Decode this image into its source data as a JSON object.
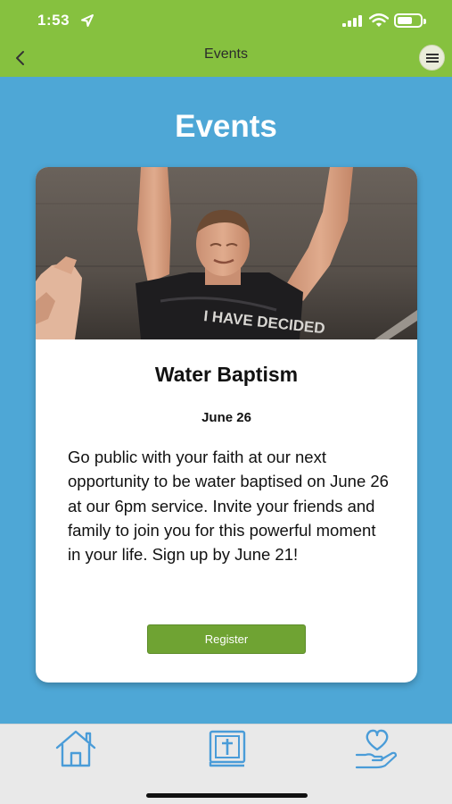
{
  "status_bar": {
    "time": "1:53"
  },
  "nav": {
    "title": "Events"
  },
  "page": {
    "heading": "Events"
  },
  "event": {
    "title": "Water Baptism",
    "date": "June 26",
    "description": "Go public with your faith at our next opportunity to be water baptised on June 26 at our 6pm service. Invite your friends and family to join you for this powerful moment in your life. Sign up by June 21!",
    "register_label": "Register",
    "shirt_text": "I HAVE DECIDED"
  },
  "tabs": [
    {
      "icon": "home-icon"
    },
    {
      "icon": "bible-icon"
    },
    {
      "icon": "giving-heart-icon"
    }
  ],
  "colors": {
    "header_green": "#86c13f",
    "page_blue": "#4ea7d6",
    "button_green": "#6fa333",
    "icon_blue": "#4a9cd8"
  }
}
